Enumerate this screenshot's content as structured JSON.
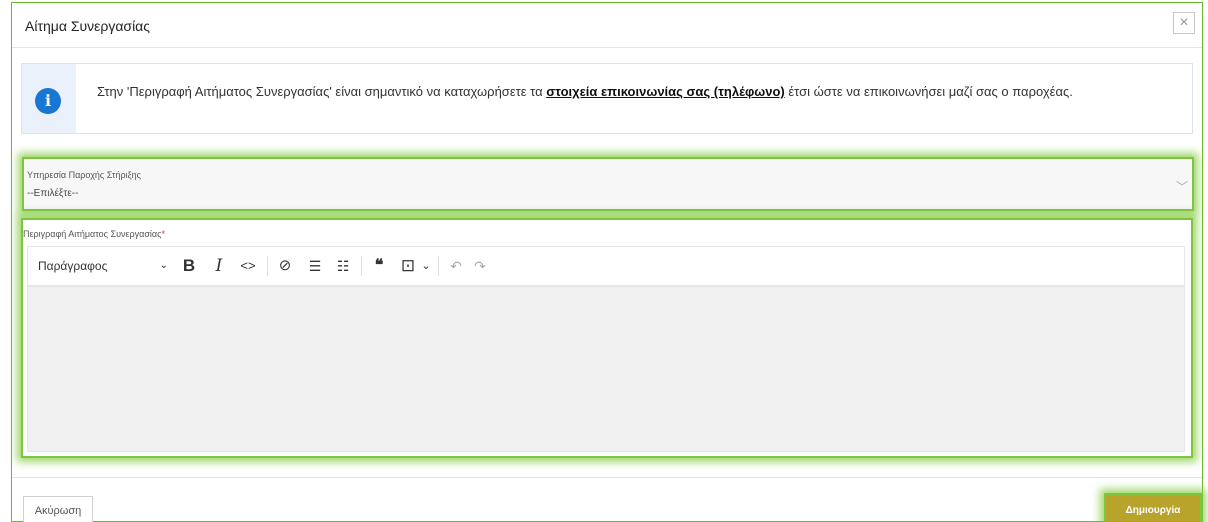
{
  "modal": {
    "title": "Αίτημα Συνεργασίας",
    "close_label": "×"
  },
  "info": {
    "icon": "info-icon",
    "icon_glyph": "i",
    "text_before": "Στην 'Περιγραφή Αιτήματος Συνεργασίας' είναι σημαντικό να καταχωρήσετε τα ",
    "text_bold": "στοιχεία επικοινωνίας σας (τηλέφωνο)",
    "text_after": " έτσι ώστε να επικοινωνήσει μαζί σας ο παροχέας."
  },
  "service_select": {
    "label": "Υπηρεσία Παροχής Στήριξης",
    "value": "--Επιλέξτε--",
    "chevron": "﹀"
  },
  "editor": {
    "label": "Περιγραφή Αιτήματος Συνεργασίας",
    "required_mark": "*",
    "paragraph_format": "Παράγραφος",
    "caret": "⌄",
    "tools": {
      "bold": "B",
      "italic": "I",
      "code": "<>",
      "link": "⊘",
      "bulleted_list": "☰",
      "numbered_list": "☷",
      "blockquote": "❝",
      "insert": "⊡",
      "insert_caret": "⌄",
      "undo": "↶",
      "redo": "↷"
    }
  },
  "footer": {
    "cancel_label": "Ακύρωση",
    "create_label": "Δημιουργία"
  },
  "colors": {
    "highlight": "#7cc63e",
    "info_icon": "#1877d2",
    "create_button": "#b9a42b"
  }
}
